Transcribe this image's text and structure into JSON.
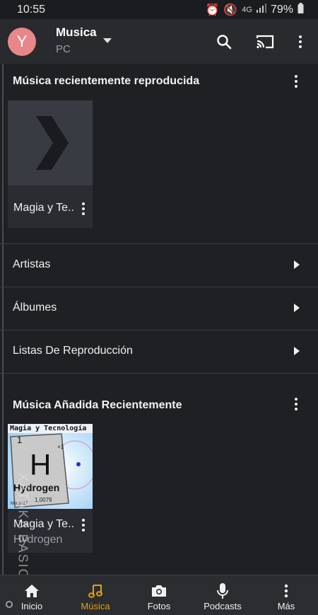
{
  "status_bar": {
    "time": "10:55",
    "network_label": "4G",
    "battery": "79%"
  },
  "app_bar": {
    "avatar_letter": "Y",
    "server_name": "Musica",
    "server_sub": "PC"
  },
  "recent_played": {
    "title": "Música recientemente reproducida",
    "items": [
      {
        "title": "Magia y Te.."
      }
    ]
  },
  "nav_rows": [
    {
      "label": "Artistas"
    },
    {
      "label": "Álbumes"
    },
    {
      "label": "Listas De Reproducción"
    }
  ],
  "recent_added": {
    "title": "Música Añadida Recientemente",
    "items": [
      {
        "title": "Magia y Te..",
        "subtitle": "Hydrogen"
      }
    ]
  },
  "album_art": {
    "header": "Magia y Tecnología",
    "element_number": "1",
    "element_mass_top": "+1",
    "element_symbol": "H",
    "element_name": "Hydrogen",
    "element_mass": "1,0079",
    "corner_text": "Mix 2017"
  },
  "watermark": "XATAKA BASICS",
  "bottom_nav": [
    {
      "label": "Inicio",
      "icon": "home-icon",
      "active": false
    },
    {
      "label": "Música",
      "icon": "music-note-icon",
      "active": true
    },
    {
      "label": "Fotos",
      "icon": "camera-icon",
      "active": false
    },
    {
      "label": "Podcasts",
      "icon": "microphone-icon",
      "active": false
    },
    {
      "label": "Más",
      "icon": "more-vertical-icon",
      "active": false
    }
  ],
  "colors": {
    "accent": "#e5a00d",
    "background": "#1f2023",
    "avatar": "#e8878a"
  }
}
